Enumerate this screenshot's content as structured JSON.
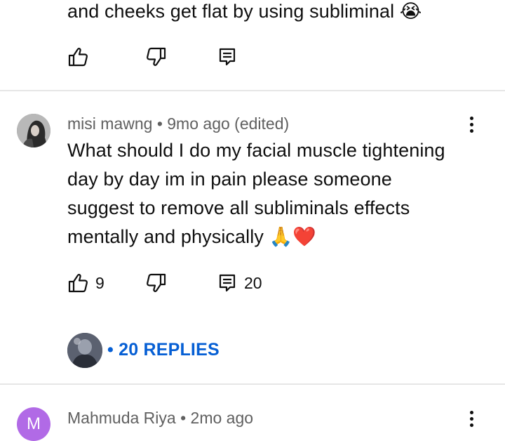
{
  "comment_top": {
    "text_end": "and cheeks  get flat by using subliminal 😭"
  },
  "comment_main": {
    "author": "misi mawng",
    "separator": "•",
    "time": "9mo ago (edited)",
    "text_lines": [
      "What should I do my facial muscle tightening",
      "day by day im in pain please someone",
      "suggest to remove all subliminals effects",
      "mentally and physically 🙏❤️"
    ],
    "likes": "9",
    "reply_count": "20",
    "replies_link": "• 20 REPLIES"
  },
  "comment_bottom": {
    "avatar_letter": "M",
    "author": "Mahmuda Riya",
    "separator": "•",
    "time": "2mo ago"
  },
  "colors": {
    "link_blue": "#065fd4",
    "meta_gray": "#606060",
    "avatar_purple": "#b16ae6"
  },
  "icons": [
    "thumb-up-icon",
    "thumb-down-icon",
    "reply-icon",
    "more-vert-icon"
  ]
}
